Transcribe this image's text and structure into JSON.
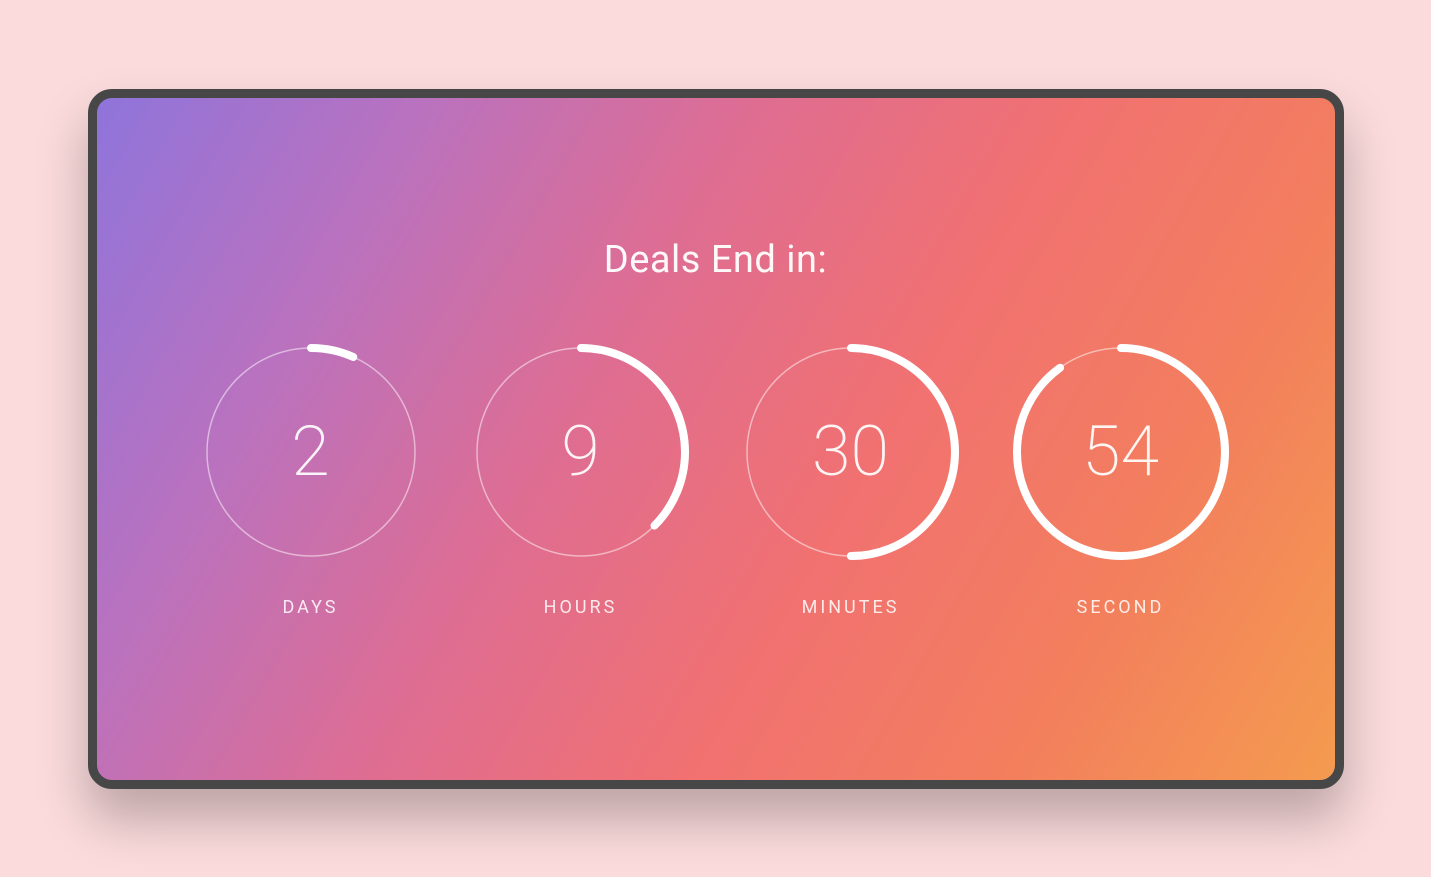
{
  "title": "Deals End in:",
  "countdown": {
    "days": {
      "value": "2",
      "max": 30,
      "current": 2,
      "label": "DAYS"
    },
    "hours": {
      "value": "9",
      "max": 24,
      "current": 9,
      "label": "HOURS"
    },
    "minutes": {
      "value": "30",
      "max": 60,
      "current": 30,
      "label": "MINUTES"
    },
    "seconds": {
      "value": "54",
      "max": 60,
      "current": 54,
      "label": "SECOND"
    }
  },
  "ring": {
    "radius": 104,
    "circumference": 653.45
  }
}
